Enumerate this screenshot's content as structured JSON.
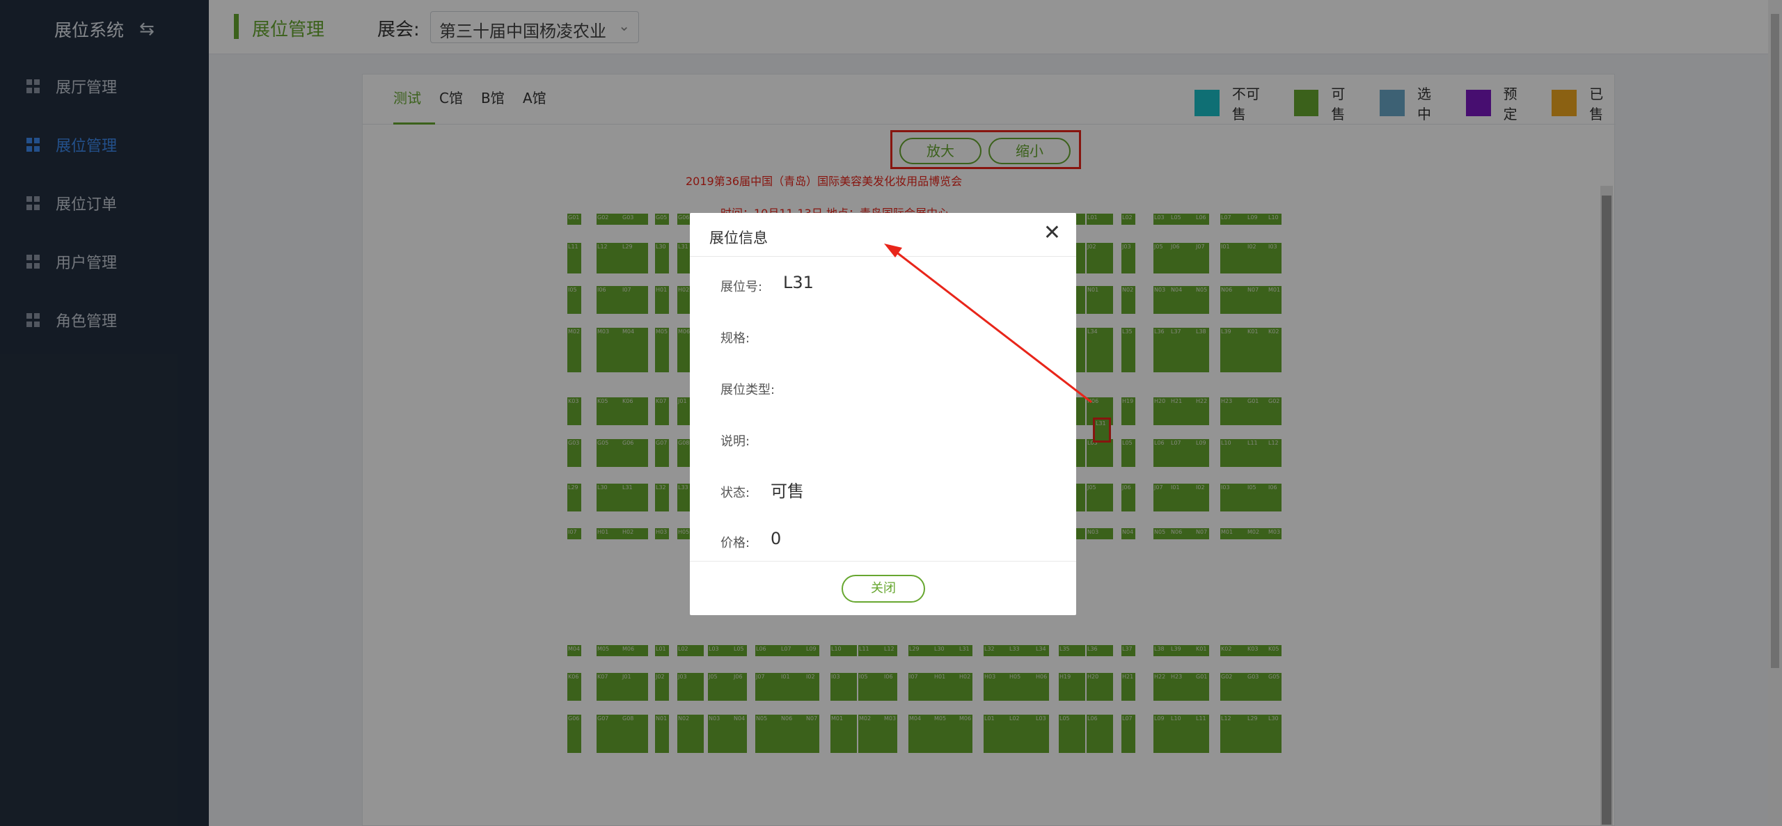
{
  "sidebar": {
    "brand": "展位系统",
    "items": [
      {
        "label": "展厅管理",
        "active": false
      },
      {
        "label": "展位管理",
        "active": true
      },
      {
        "label": "展位订单",
        "active": false
      },
      {
        "label": "用户管理",
        "active": false
      },
      {
        "label": "角色管理",
        "active": false
      }
    ]
  },
  "header": {
    "title": "展位管理",
    "expo_label": "展会:",
    "expo_value": "第三十届中国杨凌农业"
  },
  "tabs": [
    "测试",
    "C馆",
    "B馆",
    "A馆"
  ],
  "legend": [
    {
      "label": "不可售",
      "color": "#1bbfc8"
    },
    {
      "label": "可售",
      "color": "#67a730"
    },
    {
      "label": "选中",
      "color": "#6aa8c9"
    },
    {
      "label": "预定",
      "color": "#7a19c2"
    },
    {
      "label": "已售",
      "color": "#f0a820"
    }
  ],
  "zoom": {
    "zoom_in": "放大",
    "zoom_out": "缩小"
  },
  "exhibit": {
    "title": "2019第36届中国（青岛）国际美容美发化妆用品博览会",
    "info": "时间：10月11-13日 地点：青岛国际会展中心"
  },
  "booths": {
    "row_labels": [
      "G01",
      "G02",
      "G03",
      "G05",
      "G06",
      "G07",
      "G08",
      "N01",
      "N02",
      "N03",
      "N04",
      "N05",
      "N06",
      "N07",
      "M01",
      "M02",
      "M03",
      "M04",
      "M05",
      "M06",
      "L01",
      "L02",
      "L03",
      "L05",
      "L06",
      "L07",
      "L09",
      "L10",
      "L11",
      "L12",
      "L29",
      "L30",
      "L31",
      "L32",
      "L33",
      "L34",
      "L35",
      "L36",
      "L37",
      "L38",
      "L39",
      "K01",
      "K02",
      "K03",
      "K05",
      "K06",
      "K07",
      "J01",
      "J02",
      "J03",
      "J05",
      "J06",
      "J07",
      "I01",
      "I02",
      "I03",
      "I05",
      "I06",
      "I07",
      "H01",
      "H02",
      "H03",
      "H05",
      "H06",
      "H19",
      "H20",
      "H21",
      "H22",
      "H23"
    ],
    "selected": "L31"
  },
  "modal": {
    "title": "展位信息",
    "fields": [
      {
        "label": "展位号:",
        "value": "L31"
      },
      {
        "label": "规格:",
        "value": ""
      },
      {
        "label": "展位类型:",
        "value": ""
      },
      {
        "label": "说明:",
        "value": ""
      },
      {
        "label": "状态:",
        "value": "可售"
      },
      {
        "label": "价格:",
        "value": "0"
      }
    ],
    "close_label": "关闭"
  }
}
